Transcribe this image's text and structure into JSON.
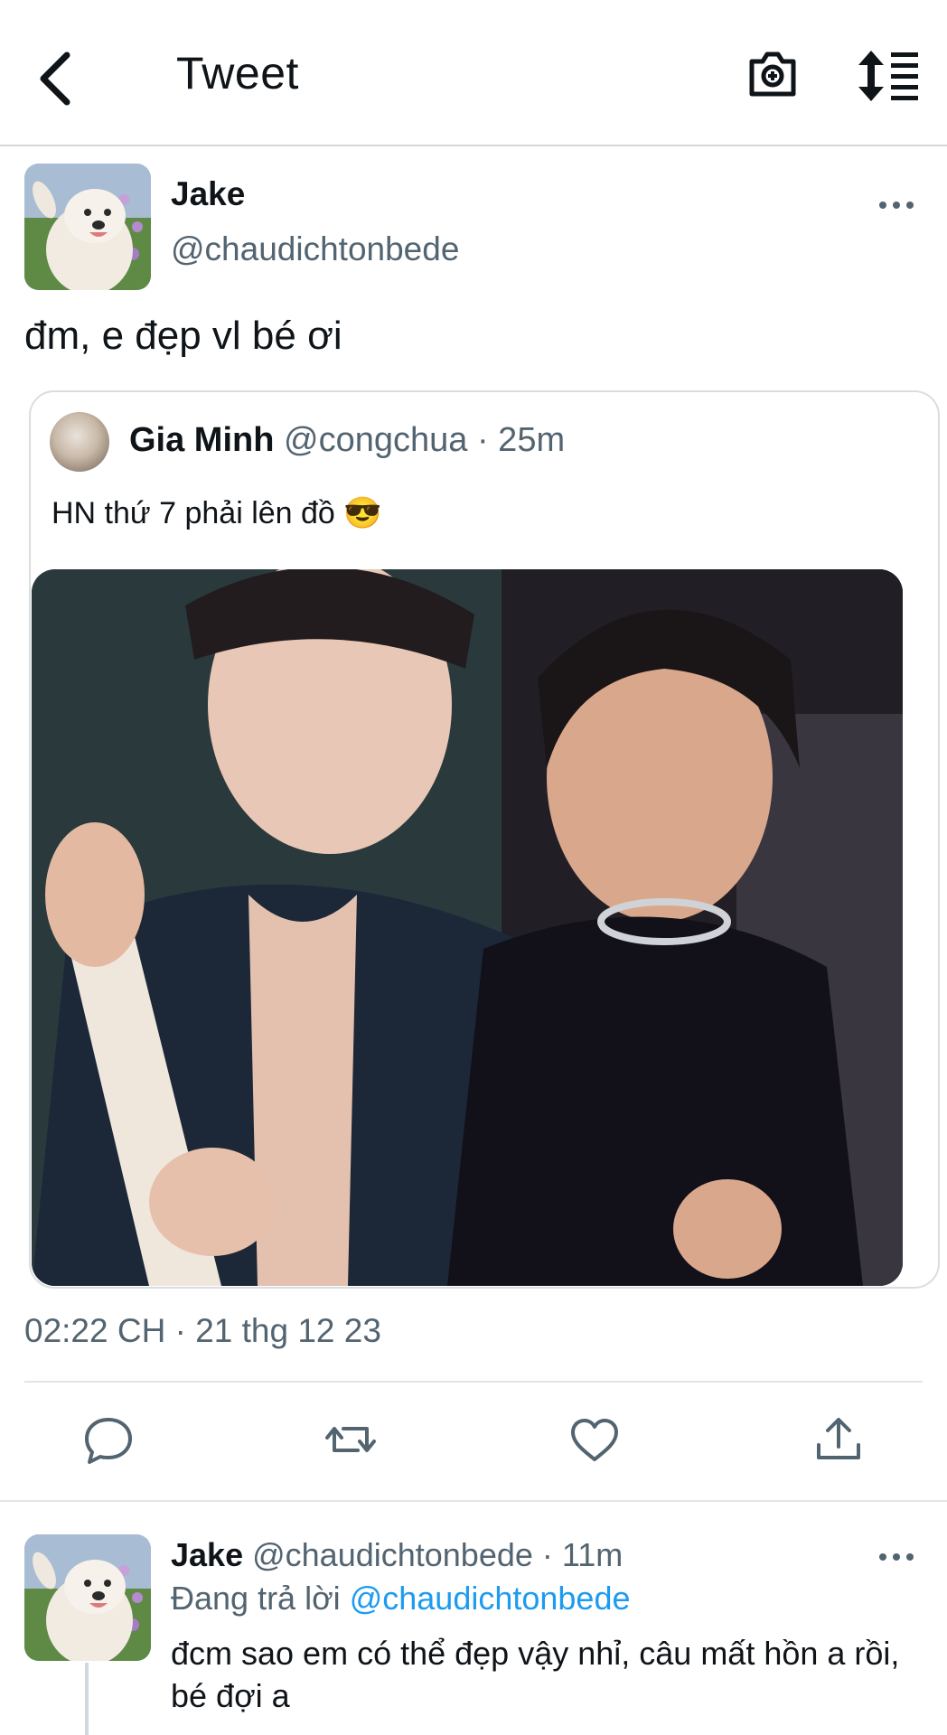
{
  "header": {
    "title": "Tweet",
    "back_icon": "chevron-left-icon",
    "camera_icon": "camera-icon",
    "sort_icon": "sort-icon"
  },
  "tweet": {
    "name": "Jake",
    "handle": "@chaudichtonbede",
    "text": "đm, e đẹp vl bé ơi",
    "quote": {
      "name": "Gia Minh",
      "handle": "@congchua",
      "time": "· 25m",
      "text": "HN thứ 7 phải lên đồ 😎"
    },
    "timestamp": "02:22 CH · 21 thg 12 23",
    "actions": [
      "reply-icon",
      "retweet-icon",
      "like-icon",
      "share-icon"
    ]
  },
  "reply": {
    "name": "Jake",
    "handle": "@chaudichtonbede",
    "time": "· 11m",
    "replying_prefix": "Đang trả lời",
    "replying_to": "@chaudichtonbede",
    "text": "đcm sao em có thể đẹp vậy nhỉ, câu mất hồn a rồi, bé đợi a"
  },
  "colors": {
    "link": "#1d9bf0",
    "secondary": "#536471",
    "primary": "#0f1419",
    "divider": "#e1e5e8"
  }
}
